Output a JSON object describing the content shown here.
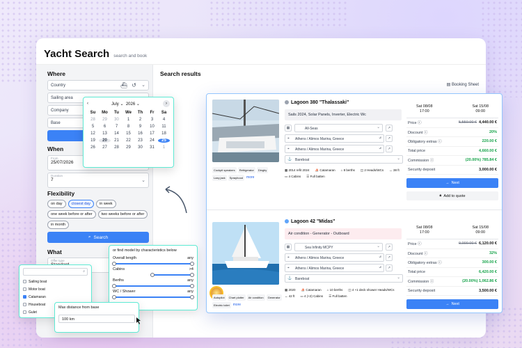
{
  "app": {
    "title": "Yacht Search",
    "subtitle": "search and book"
  },
  "where": {
    "heading": "Where",
    "fields": [
      "Country",
      "Sailing area",
      "Company",
      "Base"
    ]
  },
  "when": {
    "heading": "When",
    "from_label": "From",
    "from_value": "25/07/2026",
    "duration_label": "Duration",
    "duration_value": "7"
  },
  "flexibility": {
    "heading": "Flexibility",
    "options": [
      "on day",
      "closest day",
      "in week",
      "one week before or after",
      "two weeks before or after",
      "in month"
    ]
  },
  "search_button": "Search",
  "what": {
    "heading": "What",
    "offer_type_label": "Offer type",
    "offer_type_value": "Standard"
  },
  "results": {
    "heading": "Search results",
    "booking_sheet": "Booking Sheet"
  },
  "calendar": {
    "month": "July",
    "year": "2026",
    "weekdays": [
      "Su",
      "Mo",
      "Tu",
      "We",
      "Th",
      "Fr",
      "Sa"
    ],
    "rows": [
      [
        "28",
        "29",
        "30",
        "1",
        "2",
        "3",
        "4"
      ],
      [
        "5",
        "6",
        "7",
        "8",
        "9",
        "10",
        "11"
      ],
      [
        "12",
        "13",
        "14",
        "15",
        "16",
        "17",
        "18"
      ],
      [
        "19",
        "20",
        "21",
        "22",
        "23",
        "24",
        "25"
      ],
      [
        "26",
        "27",
        "28",
        "29",
        "30",
        "31",
        "1"
      ]
    ],
    "today": "20",
    "selected": "25"
  },
  "cards": [
    {
      "name": "Lagoon 380 \"Thalassaki\"",
      "status_color": "#9ca3af",
      "features": "Sails 2024, Solar Panels, Inverter, Electric Wc",
      "features_bg": "#f1f1f4",
      "charter": "All-Seas",
      "base1": "Athens / Alimos Marina, Greece",
      "base2": "Athens / Alimos Marina, Greece",
      "service": "Bareboat",
      "tags": [
        "Cockpit speakers",
        "Refrigerator",
        "Dinghy",
        "Lazy jack",
        "Sprayhood"
      ],
      "more": "more",
      "specs": [
        "2014 refit 2024",
        "Catamaran",
        "8 berths",
        "2 Heads/WCs",
        "38 ft",
        "4 Cabins",
        "Full batten"
      ],
      "date_from": "Sat 08/08",
      "time_from": "17:00",
      "date_to": "Sat 15/08",
      "time_to": "09:00",
      "price_label": "Price",
      "price_old": "5,550.00 €",
      "price_new": "4,440.00 €",
      "discount_label": "Discount",
      "discount": "20%",
      "extras_label": "Obligatory extras",
      "extras": "220.00 €",
      "total_label": "Total price",
      "total": "4,660.00 €",
      "commission_label": "Commission",
      "commission": "(20.00%) 785.84 €",
      "deposit_label": "Security deposit",
      "deposit": "3,000.00 €",
      "next": "Next",
      "quote": "Add to quote"
    },
    {
      "name": "Lagoon 42 \"Midas\"",
      "status_color": "#60a5fa",
      "features": "Air condition - Generator - Outboard",
      "features_bg": "#fdecef",
      "charter": "Sea Infinity MCPY",
      "base1": "Athens / Alimos Marina, Greece",
      "base2": "Athens / Alimos Marina, Greece",
      "service": "Bareboat",
      "tags": [
        "Autopilot",
        "Chart plotter",
        "Air condition",
        "Generator",
        "Electric toilet"
      ],
      "more": "more",
      "specs": [
        "2020",
        "Catamaran",
        "10 berths",
        "4 +1 deck shower Heads/WCs",
        "42 ft",
        "4 (+2) Cabins",
        "Full batten"
      ],
      "date_from": "Sat 08/08",
      "time_from": "17:00",
      "date_to": "Sat 15/08",
      "time_to": "09:00",
      "price_label": "Price",
      "price_old": "9,000.00 €",
      "price_new": "6,120.00 €",
      "discount_label": "Discount",
      "discount": "32%",
      "extras_label": "Obligatory extras",
      "extras": "300.00 €",
      "total_label": "Total price",
      "total": "6,420.00 €",
      "commission_label": "Commission",
      "commission": "(20.00%) 1,062.86 €",
      "deposit_label": "Security deposit",
      "deposit": "3,500.00 €",
      "next": "Next"
    }
  ],
  "boat_types": {
    "options": [
      "Sailing boat",
      "Motor boat",
      "Catamaran",
      "Houseboat",
      "Gulet"
    ],
    "checked": [
      "Catamaran"
    ]
  },
  "distance": {
    "label": "Max distance from base",
    "value": "100 km"
  },
  "model": {
    "title": "or find model by characteristics below",
    "rows": [
      {
        "label": "Overall length",
        "value": "any"
      },
      {
        "label": "Cabins",
        "value": ">4"
      },
      {
        "label": "Berths",
        "value": "any"
      },
      {
        "label": "WC / Shower",
        "value": "any"
      }
    ]
  },
  "colors": {
    "accent": "#3b82f6",
    "highlight": "#5eead4",
    "green": "#16a34a"
  }
}
